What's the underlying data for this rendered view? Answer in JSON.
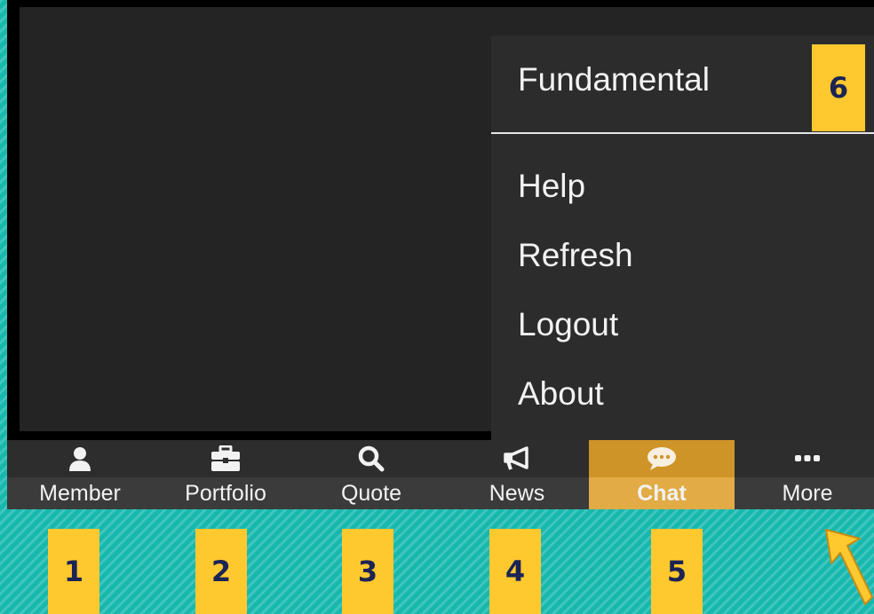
{
  "menu": {
    "items": [
      "Fundamental",
      "Help",
      "Refresh",
      "Logout",
      "About"
    ]
  },
  "tabs": [
    {
      "label": "Member",
      "icon": "user-icon"
    },
    {
      "label": "Portfolio",
      "icon": "briefcase-icon"
    },
    {
      "label": "Quote",
      "icon": "search-icon"
    },
    {
      "label": "News",
      "icon": "megaphone-icon"
    },
    {
      "label": "Chat",
      "icon": "chat-bubble-icon",
      "active": true
    },
    {
      "label": "More",
      "icon": "ellipsis-icon"
    }
  ],
  "annotations": {
    "badges": [
      "1",
      "2",
      "3",
      "4",
      "5",
      "6"
    ],
    "arrow_icon": "pointer-arrow-icon"
  },
  "colors": {
    "background": "#17b8ae",
    "active_tab": "#cf9428",
    "badge": "#fec82f",
    "badge_text": "#1c2454"
  }
}
